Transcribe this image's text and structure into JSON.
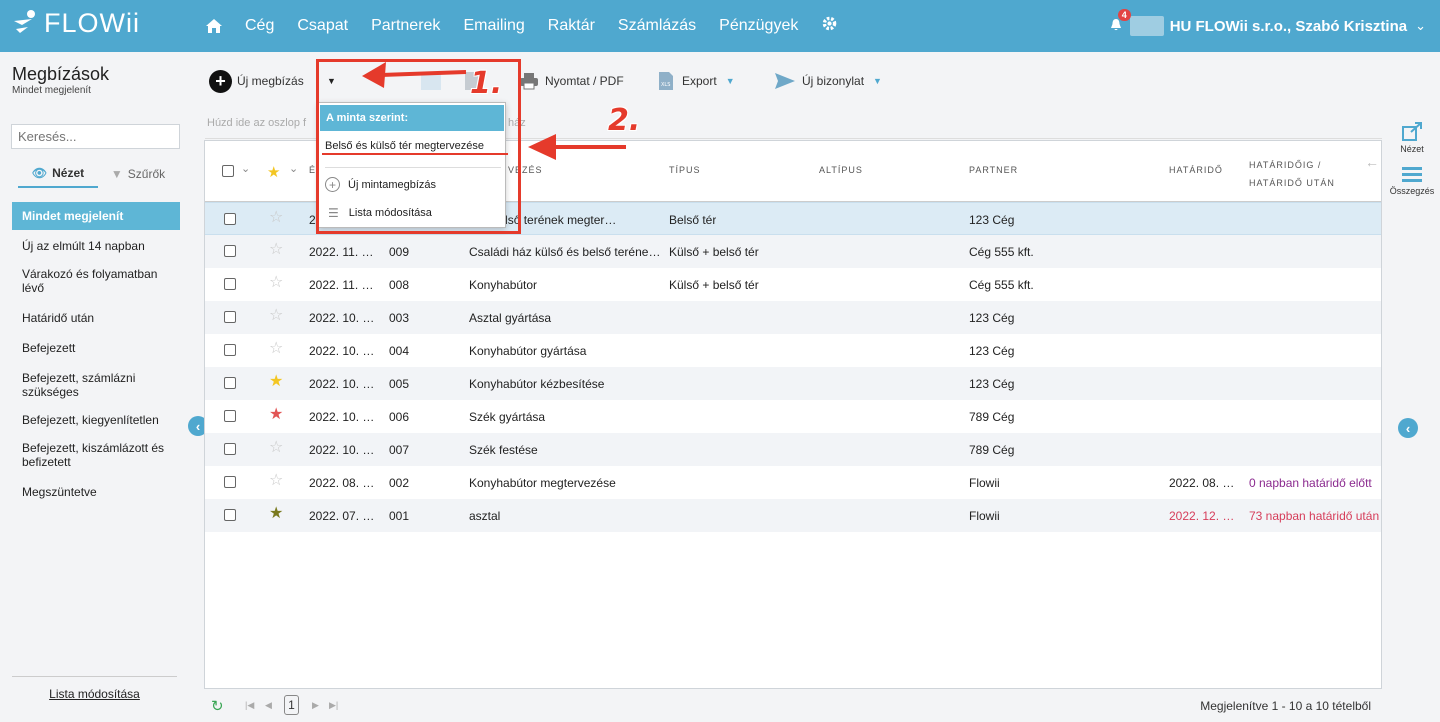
{
  "app": {
    "logo_text": "FLOWii"
  },
  "nav": {
    "items": [
      "Cég",
      "Csapat",
      "Partnerek",
      "Emailing",
      "Raktár",
      "Számlázás",
      "Pénzügyek"
    ]
  },
  "user": {
    "name": "HU FLOWii s.r.o., Szabó Krisztina",
    "notification_count": "4"
  },
  "sidebar": {
    "title": "Megbízások",
    "subtitle": "Mindet megjelenít",
    "search_placeholder": "Keresés...",
    "tab_view": "Nézet",
    "tab_filters": "Szűrők",
    "items": [
      "Mindet megjelenít",
      "Új az elmúlt 14 napban",
      "Várakozó és folyamatban lévő",
      "Határidő után",
      "Befejezett",
      "Befejezett, számlázni szükséges",
      "Befejezett, kiegyenlítetlen",
      "Befejezett, kiszámlázott és befizetett",
      "Megszüntetve"
    ],
    "footer_link": "Lista módosítása"
  },
  "toolbar": {
    "new_label": "Új megbízás",
    "print_label": "Nyomtat / PDF",
    "export_label": "Export",
    "new_doc_label": "Új bizonylat"
  },
  "group_hint": {
    "left": "Húzd ide az oszlop f",
    "right": "ház"
  },
  "grid": {
    "headers": {
      "name_partial": "É",
      "name_col_partial": "VEZÉS",
      "type": "Típus",
      "subtype": "Altípus",
      "partner": "Partner",
      "deadline": "Határidő",
      "deadline_rel": "Határidőig / határidő után"
    },
    "rows": [
      {
        "date": "2",
        "num": "",
        "name": "ház belső terének megter…",
        "type": "Belső tér",
        "partner": "123 Cég",
        "deadline": "",
        "rel": "",
        "star": "empty"
      },
      {
        "date": "2022. 11. …",
        "num": "009",
        "name": "Családi ház külső és belső teréne…",
        "type": "Külső + belső tér",
        "partner": "Cég 555 kft.",
        "deadline": "",
        "rel": "",
        "star": "empty"
      },
      {
        "date": "2022. 11. …",
        "num": "008",
        "name": "Konyhabútor",
        "type": "Külső + belső tér",
        "partner": "Cég 555 kft.",
        "deadline": "",
        "rel": "",
        "star": "empty"
      },
      {
        "date": "2022. 10. …",
        "num": "003",
        "name": "Asztal gyártása",
        "type": "",
        "partner": "123 Cég",
        "deadline": "",
        "rel": "",
        "star": "empty"
      },
      {
        "date": "2022. 10. …",
        "num": "004",
        "name": "Konyhabútor gyártása",
        "type": "",
        "partner": "123 Cég",
        "deadline": "",
        "rel": "",
        "star": "empty"
      },
      {
        "date": "2022. 10. …",
        "num": "005",
        "name": "Konyhabútor kézbesítése",
        "type": "",
        "partner": "123 Cég",
        "deadline": "",
        "rel": "",
        "star": "gold"
      },
      {
        "date": "2022. 10. …",
        "num": "006",
        "name": "Szék gyártása",
        "type": "",
        "partner": "789 Cég",
        "deadline": "",
        "rel": "",
        "star": "red"
      },
      {
        "date": "2022. 10. …",
        "num": "007",
        "name": "Szék festése",
        "type": "",
        "partner": "789 Cég",
        "deadline": "",
        "rel": "",
        "star": "empty"
      },
      {
        "date": "2022. 08. …",
        "num": "002",
        "name": "Konyhabútor megtervezése",
        "type": "",
        "partner": "Flowii",
        "deadline": "2022. 08. …",
        "rel": "0 napban határidő előtt",
        "star": "empty"
      },
      {
        "date": "2022. 07. …",
        "num": "001",
        "name": "asztal",
        "type": "",
        "partner": "Flowii",
        "deadline": "2022. 12. …",
        "rel": "73 napban határidő után",
        "star": "olive"
      }
    ]
  },
  "pager": {
    "page": "1",
    "summary": "Megjelenítve 1 - 10 a 10 tételből"
  },
  "right_panel": {
    "view": "Nézet",
    "summary": "Összegzés"
  },
  "dropdown": {
    "header": "A minta szerint:",
    "template_item": "Belső és külső tér megtervezése",
    "new_template": "Új mintamegbízás",
    "edit_list": "Lista módosítása"
  },
  "annotations": {
    "step1": "1.",
    "step2": "2."
  },
  "colors": {
    "accent": "#4fa8cf",
    "annotation_red": "#e53a2b"
  }
}
